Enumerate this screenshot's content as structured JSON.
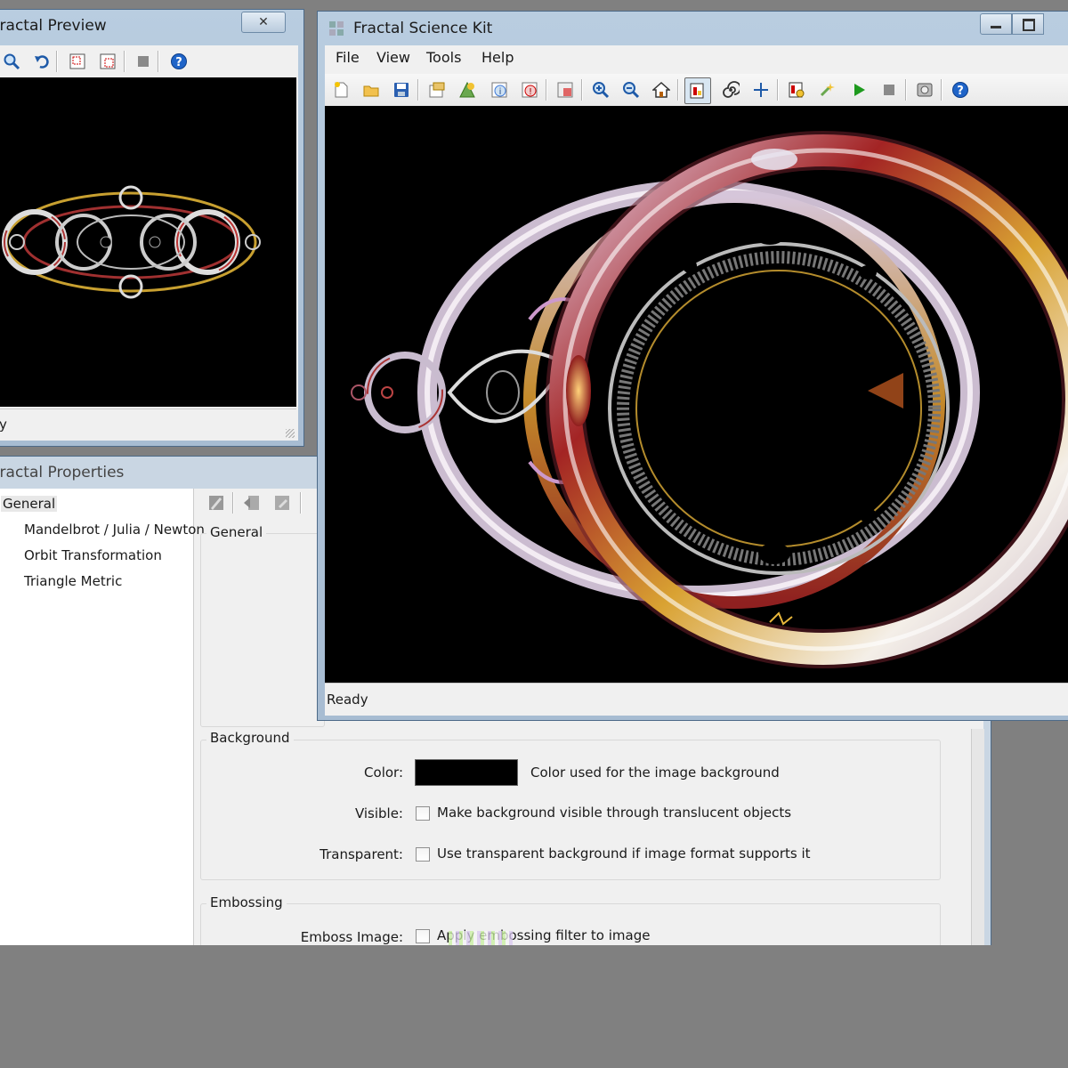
{
  "preview_window": {
    "title": "Fractal Preview",
    "close_glyph": "✕",
    "status": "y"
  },
  "properties_window": {
    "title": "Fractal Properties",
    "tree": [
      "General",
      "Mandelbrot / Julia / Newton",
      "Orbit Transformation",
      "Triangle Metric"
    ],
    "general_group": "General",
    "background_group": "Background",
    "color_label": "Color:",
    "color_value": "#000000",
    "color_desc": "Color used for the image background",
    "visible_label": "Visible:",
    "visible_desc": "Make background visible through translucent objects",
    "transparent_label": "Transparent:",
    "transparent_desc": "Use transparent background if image format supports it",
    "embossing_group": "Embossing",
    "emboss_label": "Emboss Image:",
    "emboss_desc": "Apply embossing filter to image"
  },
  "main_window": {
    "title": "Fractal Science Kit",
    "menu": [
      "File",
      "View",
      "Tools",
      "Help"
    ],
    "status": "Ready",
    "window_buttons": [
      "minimize-icon",
      "maximize-icon"
    ]
  },
  "colors": {
    "title_bar": "#b9cde0",
    "help_blue": "#1f64c8",
    "play_green": "#1e9a1e"
  }
}
